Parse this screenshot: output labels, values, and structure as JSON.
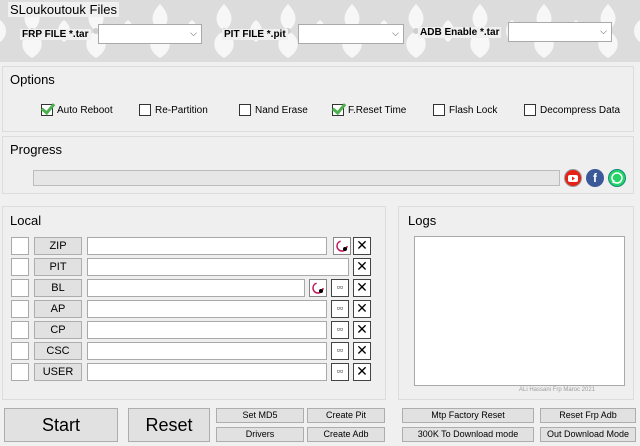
{
  "header": {
    "title": "SLoukoutouk Files",
    "frp_label": "FRP FILE *.tar",
    "pit_label": "PIT FILE *.pit",
    "adb_label": "ADB Enable *.tar"
  },
  "options": {
    "title": "Options",
    "items": [
      {
        "label": "Auto Reboot",
        "checked": true
      },
      {
        "label": "Re-Partition",
        "checked": false
      },
      {
        "label": "Nand Erase",
        "checked": false
      },
      {
        "label": "F.Reset Time",
        "checked": true
      },
      {
        "label": "Flash Lock",
        "checked": false
      },
      {
        "label": "Decompress Data",
        "checked": false
      }
    ]
  },
  "progress": {
    "title": "Progress",
    "value": 0,
    "icons": [
      "youtube-icon",
      "facebook-icon",
      "whatsapp-icon"
    ]
  },
  "local": {
    "title": "Local",
    "rows": [
      {
        "label": "ZIP"
      },
      {
        "label": "PIT"
      },
      {
        "label": "BL"
      },
      {
        "label": "AP"
      },
      {
        "label": "CP"
      },
      {
        "label": "CSC"
      },
      {
        "label": "USER"
      }
    ]
  },
  "logs": {
    "title": "Logs",
    "watermark": "ALi Hassani Frp Maroc 2021"
  },
  "buttons": {
    "start": "Start",
    "reset": "Reset",
    "set_md5": "Set MD5",
    "create_pit": "Create Pit",
    "drivers": "Drivers",
    "create_adb": "Create Adb",
    "mtp_factory_reset": "Mtp Factory Reset",
    "reset_frp_adb": "Reset Frp Adb",
    "download_300k": "300K To Download mode",
    "out_download": "Out Download Mode"
  },
  "colors": {
    "check_green": "#4caf50",
    "youtube": "#e62117",
    "facebook": "#3b5998",
    "whatsapp": "#25d366"
  }
}
